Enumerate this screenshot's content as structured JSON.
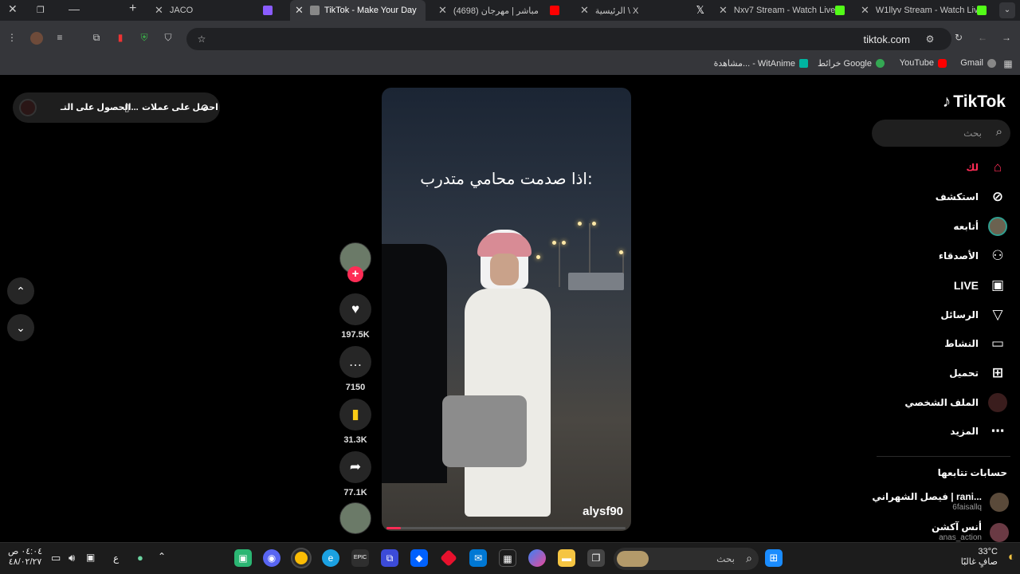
{
  "browser": {
    "tabs": [
      {
        "title": "JACO",
        "favicon_color": "#ff5c8a"
      },
      {
        "title": "TikTok - Make Your Day",
        "favicon_color": "#000000",
        "active": true
      },
      {
        "title": "(4698) مباشر | مهرجان",
        "favicon_color": "#ff0000"
      },
      {
        "title": "الرئيسية \\ X",
        "favicon_color": "#ffffff"
      },
      {
        "title": "Nxv7 Stream - Watch Live",
        "favicon_color": "#53fc18"
      },
      {
        "title": "W1llyv Stream - Watch Live",
        "favicon_color": "#53fc18"
      }
    ],
    "new_tab_label": "+",
    "url": "tiktok.com",
    "bookmarks": [
      {
        "label": "Gmail",
        "color": "#ea4335"
      },
      {
        "label": "YouTube",
        "color": "#ff0000"
      },
      {
        "label": "خرائط Google",
        "color": "#34a853"
      },
      {
        "label": "مشاهدة... - WitAnime",
        "color": "#f4c20d"
      }
    ]
  },
  "promo": {
    "get_coins": "احصل على عملات",
    "get_app": "الحصول على التـ..."
  },
  "video": {
    "caption": "اذا صدمت محامي متدرب:",
    "username": "alysf90",
    "progress": 0.06
  },
  "actions": {
    "likes": "197.5K",
    "comments": "7150",
    "saves": "31.3K",
    "shares": "77.1K"
  },
  "sidebar": {
    "logo": "TikTok",
    "search_placeholder": "بحث",
    "nav": [
      {
        "label": "لك",
        "icon": "home-icon",
        "active": true
      },
      {
        "label": "استكشف",
        "icon": "compass-icon"
      },
      {
        "label": "أتابعه",
        "icon": "avatar-icon"
      },
      {
        "label": "الأصدقاء",
        "icon": "friends-icon"
      },
      {
        "label": "LIVE",
        "icon": "live-tv-icon"
      },
      {
        "label": "الرسائل",
        "icon": "send-icon"
      },
      {
        "label": "النشاط",
        "icon": "activity-icon"
      },
      {
        "label": "تحميل",
        "icon": "upload-icon"
      },
      {
        "label": "الملف الشخصي",
        "icon": "profile-icon"
      },
      {
        "label": "المزيد",
        "icon": "more-icon"
      }
    ],
    "following_header": "حسابات تتابعها",
    "following": [
      {
        "name": "فيصل الشهراني | rani...",
        "handle": "6faisallq"
      },
      {
        "name": "أنس آكشن",
        "handle": "anas_action"
      }
    ]
  },
  "taskbar": {
    "search_placeholder": "بحث",
    "weather_temp": "33°C",
    "weather_desc": "صافٍ غالبًا",
    "time": "٠٤:٠٤ ص",
    "date": "٤٨/٠٢/٢٧",
    "lang": "ع"
  },
  "colors": {
    "accent": "#fe2c55",
    "bg": "#000000",
    "chrome_bar": "#35363a"
  }
}
